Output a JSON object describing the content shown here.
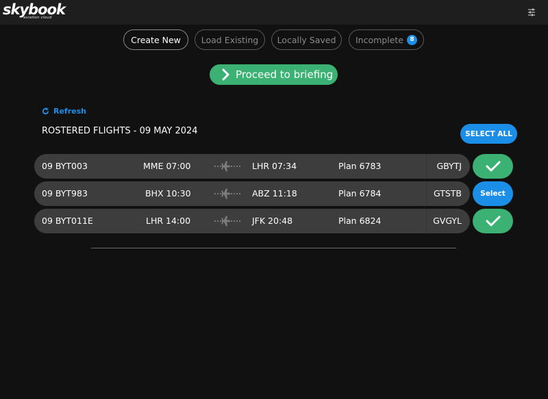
{
  "app": {
    "logo_text": "skybook",
    "logo_subtitle": "aviation cloud",
    "settings_icon": "sliders-icon"
  },
  "tabs": [
    {
      "label": "Create New",
      "active": true
    },
    {
      "label": "Load Existing",
      "active": false
    },
    {
      "label": "Locally Saved",
      "active": false
    },
    {
      "label": "Incomplete",
      "active": false,
      "badge": "8"
    }
  ],
  "proceed": {
    "label": "Proceed to briefing",
    "icon": "chevron-right-icon"
  },
  "refresh": {
    "label": "Refresh",
    "icon": "refresh-icon"
  },
  "section": {
    "title": "ROSTERED FLIGHTS - 09 MAY 2024",
    "select_all_label": "SELECT ALL"
  },
  "flights": [
    {
      "id": "09 BYT003",
      "departure": "MME 07:00",
      "arrival": "LHR 07:34",
      "plan": "Plan 6783",
      "registration": "GBYTJ",
      "selected": true,
      "action_label": ""
    },
    {
      "id": "09 BYT983",
      "departure": "BHX 10:30",
      "arrival": "ABZ 11:18",
      "plan": "Plan 6784",
      "registration": "GTSTB",
      "selected": false,
      "action_label": "Select"
    },
    {
      "id": "09 BYT011E",
      "departure": "LHR 14:00",
      "arrival": "JFK 20:48",
      "plan": "Plan 6824",
      "registration": "GVGYL",
      "selected": true,
      "action_label": ""
    }
  ],
  "colors": {
    "accent_blue": "#1b8fe8",
    "accent_green": "#3bb273",
    "background": "#111111",
    "topbar": "#1e1e1e",
    "row": "#3d3d3d"
  }
}
